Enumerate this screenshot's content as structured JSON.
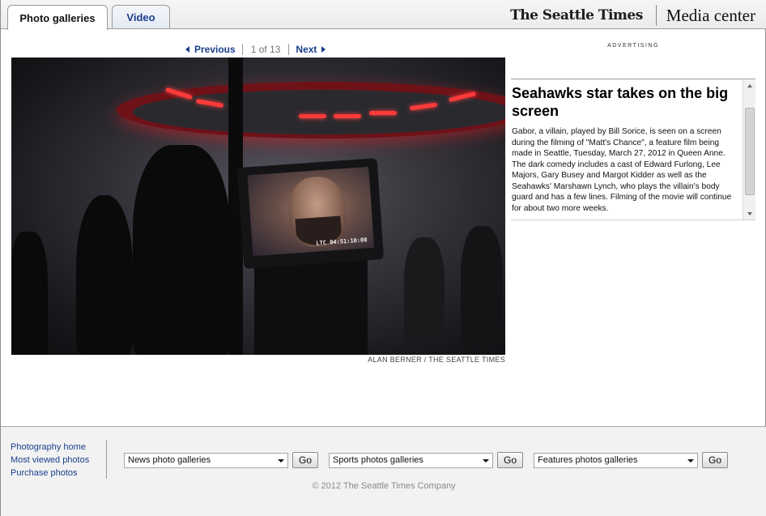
{
  "tabs": [
    {
      "label": "Photo galleries",
      "active": true
    },
    {
      "label": "Video",
      "active": false
    }
  ],
  "brand": {
    "logo_text": "The Seattle Times",
    "section": "Media center"
  },
  "pager": {
    "previous": "Previous",
    "count": "1 of 13",
    "next": "Next"
  },
  "photo": {
    "timecode": "LTC 04:51:10:00",
    "credit": "ALAN BERNER / THE SEATTLE TIMES"
  },
  "advertising_label": "ADVERTISING",
  "caption": {
    "title": "Seahawks star takes on the big screen",
    "text": "Gabor, a villain, played by Bill Sorice, is seen on a screen during the filming of \"Matt's Chance\", a feature film being made in Seattle, Tuesday, March 27, 2012 in Queen Anne. The dark comedy includes a cast of Edward Furlong, Lee Majors, Gary Busey and Margot Kidder as well as the Seahawks' Marshawn Lynch, who plays the villain's body guard and has a few lines. Filming of the movie will continue for about two more weeks."
  },
  "footer": {
    "links": [
      "Photography home",
      "Most viewed photos",
      "Purchase photos"
    ],
    "selects": [
      {
        "value": "News photo galleries",
        "button": "Go"
      },
      {
        "value": "Sports photos galleries",
        "button": "Go"
      },
      {
        "value": "Features photos galleries",
        "button": "Go"
      }
    ],
    "copyright": "© 2012 The Seattle Times Company"
  },
  "colors": {
    "link_blue": "#1a3e8c",
    "footer_bg": "#f2f2f2"
  }
}
